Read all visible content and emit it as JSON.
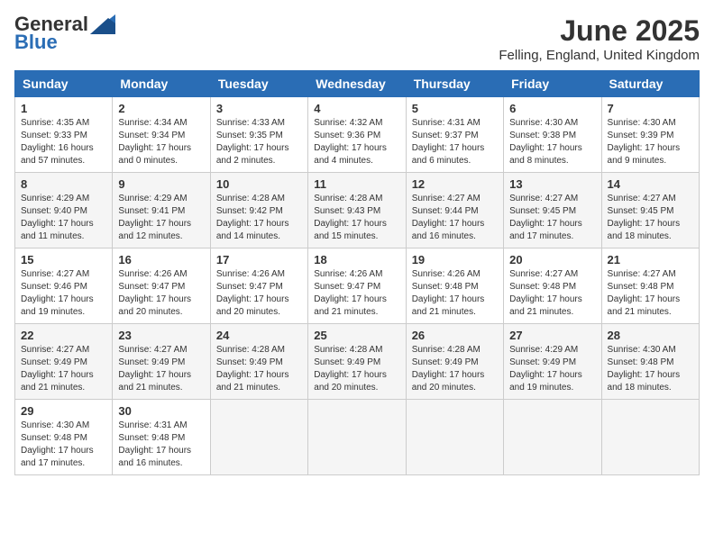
{
  "header": {
    "logo_general": "General",
    "logo_blue": "Blue",
    "month_title": "June 2025",
    "location": "Felling, England, United Kingdom"
  },
  "days_of_week": [
    "Sunday",
    "Monday",
    "Tuesday",
    "Wednesday",
    "Thursday",
    "Friday",
    "Saturday"
  ],
  "weeks": [
    [
      {
        "day": "1",
        "sunrise": "4:35 AM",
        "sunset": "9:33 PM",
        "daylight": "16 hours and 57 minutes."
      },
      {
        "day": "2",
        "sunrise": "4:34 AM",
        "sunset": "9:34 PM",
        "daylight": "17 hours and 0 minutes."
      },
      {
        "day": "3",
        "sunrise": "4:33 AM",
        "sunset": "9:35 PM",
        "daylight": "17 hours and 2 minutes."
      },
      {
        "day": "4",
        "sunrise": "4:32 AM",
        "sunset": "9:36 PM",
        "daylight": "17 hours and 4 minutes."
      },
      {
        "day": "5",
        "sunrise": "4:31 AM",
        "sunset": "9:37 PM",
        "daylight": "17 hours and 6 minutes."
      },
      {
        "day": "6",
        "sunrise": "4:30 AM",
        "sunset": "9:38 PM",
        "daylight": "17 hours and 8 minutes."
      },
      {
        "day": "7",
        "sunrise": "4:30 AM",
        "sunset": "9:39 PM",
        "daylight": "17 hours and 9 minutes."
      }
    ],
    [
      {
        "day": "8",
        "sunrise": "4:29 AM",
        "sunset": "9:40 PM",
        "daylight": "17 hours and 11 minutes."
      },
      {
        "day": "9",
        "sunrise": "4:29 AM",
        "sunset": "9:41 PM",
        "daylight": "17 hours and 12 minutes."
      },
      {
        "day": "10",
        "sunrise": "4:28 AM",
        "sunset": "9:42 PM",
        "daylight": "17 hours and 14 minutes."
      },
      {
        "day": "11",
        "sunrise": "4:28 AM",
        "sunset": "9:43 PM",
        "daylight": "17 hours and 15 minutes."
      },
      {
        "day": "12",
        "sunrise": "4:27 AM",
        "sunset": "9:44 PM",
        "daylight": "17 hours and 16 minutes."
      },
      {
        "day": "13",
        "sunrise": "4:27 AM",
        "sunset": "9:45 PM",
        "daylight": "17 hours and 17 minutes."
      },
      {
        "day": "14",
        "sunrise": "4:27 AM",
        "sunset": "9:45 PM",
        "daylight": "17 hours and 18 minutes."
      }
    ],
    [
      {
        "day": "15",
        "sunrise": "4:27 AM",
        "sunset": "9:46 PM",
        "daylight": "17 hours and 19 minutes."
      },
      {
        "day": "16",
        "sunrise": "4:26 AM",
        "sunset": "9:47 PM",
        "daylight": "17 hours and 20 minutes."
      },
      {
        "day": "17",
        "sunrise": "4:26 AM",
        "sunset": "9:47 PM",
        "daylight": "17 hours and 20 minutes."
      },
      {
        "day": "18",
        "sunrise": "4:26 AM",
        "sunset": "9:47 PM",
        "daylight": "17 hours and 21 minutes."
      },
      {
        "day": "19",
        "sunrise": "4:26 AM",
        "sunset": "9:48 PM",
        "daylight": "17 hours and 21 minutes."
      },
      {
        "day": "20",
        "sunrise": "4:27 AM",
        "sunset": "9:48 PM",
        "daylight": "17 hours and 21 minutes."
      },
      {
        "day": "21",
        "sunrise": "4:27 AM",
        "sunset": "9:48 PM",
        "daylight": "17 hours and 21 minutes."
      }
    ],
    [
      {
        "day": "22",
        "sunrise": "4:27 AM",
        "sunset": "9:49 PM",
        "daylight": "17 hours and 21 minutes."
      },
      {
        "day": "23",
        "sunrise": "4:27 AM",
        "sunset": "9:49 PM",
        "daylight": "17 hours and 21 minutes."
      },
      {
        "day": "24",
        "sunrise": "4:28 AM",
        "sunset": "9:49 PM",
        "daylight": "17 hours and 21 minutes."
      },
      {
        "day": "25",
        "sunrise": "4:28 AM",
        "sunset": "9:49 PM",
        "daylight": "17 hours and 20 minutes."
      },
      {
        "day": "26",
        "sunrise": "4:28 AM",
        "sunset": "9:49 PM",
        "daylight": "17 hours and 20 minutes."
      },
      {
        "day": "27",
        "sunrise": "4:29 AM",
        "sunset": "9:49 PM",
        "daylight": "17 hours and 19 minutes."
      },
      {
        "day": "28",
        "sunrise": "4:30 AM",
        "sunset": "9:48 PM",
        "daylight": "17 hours and 18 minutes."
      }
    ],
    [
      {
        "day": "29",
        "sunrise": "4:30 AM",
        "sunset": "9:48 PM",
        "daylight": "17 hours and 17 minutes."
      },
      {
        "day": "30",
        "sunrise": "4:31 AM",
        "sunset": "9:48 PM",
        "daylight": "17 hours and 16 minutes."
      },
      null,
      null,
      null,
      null,
      null
    ]
  ]
}
